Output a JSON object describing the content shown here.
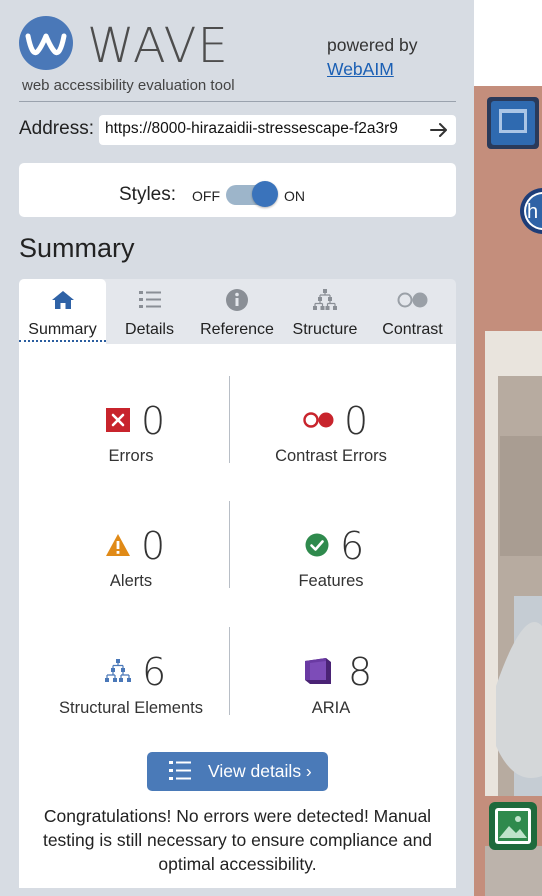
{
  "brand": {
    "wordmark": "WAVE",
    "tagline": "web accessibility evaluation tool",
    "powered_by": "powered by",
    "webaim_link": "WebAIM"
  },
  "address": {
    "label": "Address:",
    "value": "https://8000-hirazaidii-stressescape-f2a3r9"
  },
  "styles": {
    "label": "Styles:",
    "off": "OFF",
    "on": "ON",
    "state": "on"
  },
  "summary": {
    "heading": "Summary"
  },
  "tabs": [
    {
      "label": "Summary",
      "icon": "home-icon",
      "active": true
    },
    {
      "label": "Details",
      "icon": "list-icon",
      "active": false
    },
    {
      "label": "Reference",
      "icon": "info-icon",
      "active": false
    },
    {
      "label": "Structure",
      "icon": "structure-icon",
      "active": false
    },
    {
      "label": "Contrast",
      "icon": "contrast-icon",
      "active": false
    }
  ],
  "stats": {
    "errors": {
      "count": "0",
      "label": "Errors",
      "color": "#c8242c"
    },
    "contrast_errors": {
      "count": "0",
      "label": "Contrast Errors",
      "color": "#c8242c"
    },
    "alerts": {
      "count": "0",
      "label": "Alerts",
      "color": "#e08a17"
    },
    "features": {
      "count": "6",
      "label": "Features",
      "color": "#2f8a4d"
    },
    "structural": {
      "count": "6",
      "label": "Structural Elements",
      "color": "#4a78b8"
    },
    "aria": {
      "count": "8",
      "label": "ARIA",
      "color": "#5e2b8f"
    }
  },
  "view_details": {
    "label": "View details ›"
  },
  "message": "Congratulations! No errors were detected! Manual testing is still necessary to ensure compliance and optimal accessibility.",
  "colors": {
    "panel_bg": "#d7dce3",
    "accent": "#4a7ab8"
  }
}
